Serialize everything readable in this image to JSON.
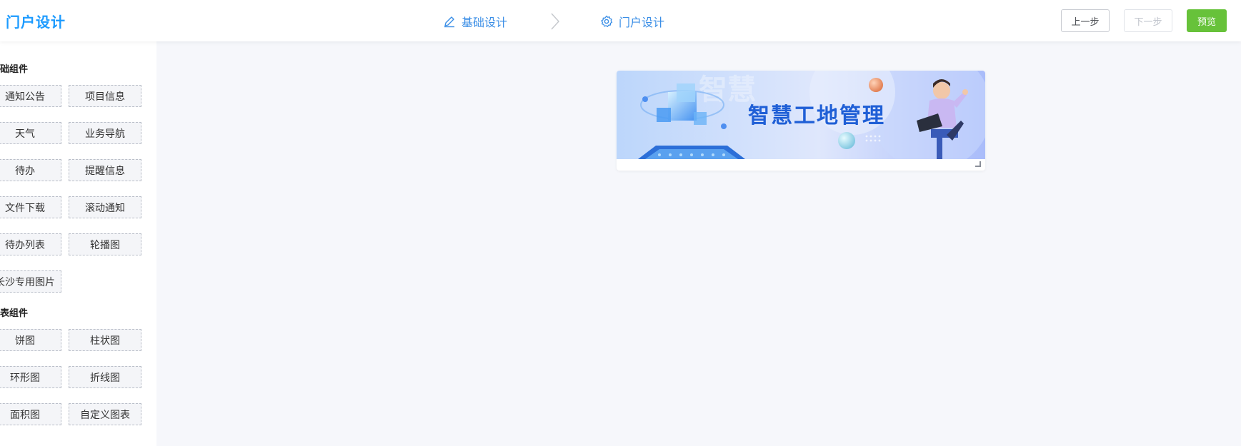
{
  "header": {
    "title": "门户设计",
    "steps": [
      {
        "label": "基础设计",
        "icon": "edit-icon"
      },
      {
        "label": "门户设计",
        "icon": "gear-icon"
      }
    ],
    "buttons": {
      "prev": "上一步",
      "next": "下一步",
      "preview": "预览"
    }
  },
  "sidebar": {
    "groups": [
      {
        "title": "础组件",
        "items": [
          "通知公告",
          "项目信息",
          "天气",
          "业务导航",
          "待办",
          "提醒信息",
          "文件下载",
          "滚动通知",
          "待办列表",
          "轮播图",
          "长沙专用图片"
        ]
      },
      {
        "title": "表组件",
        "items": [
          "饼图",
          "柱状图",
          "环形图",
          "折线图",
          "面积图",
          "自定义图表"
        ]
      }
    ]
  },
  "canvas": {
    "banner": {
      "text": "智慧工地管理"
    }
  },
  "colors": {
    "brand": "#1c9bff",
    "step": "#3a8ee6",
    "preview": "#67c23a"
  }
}
